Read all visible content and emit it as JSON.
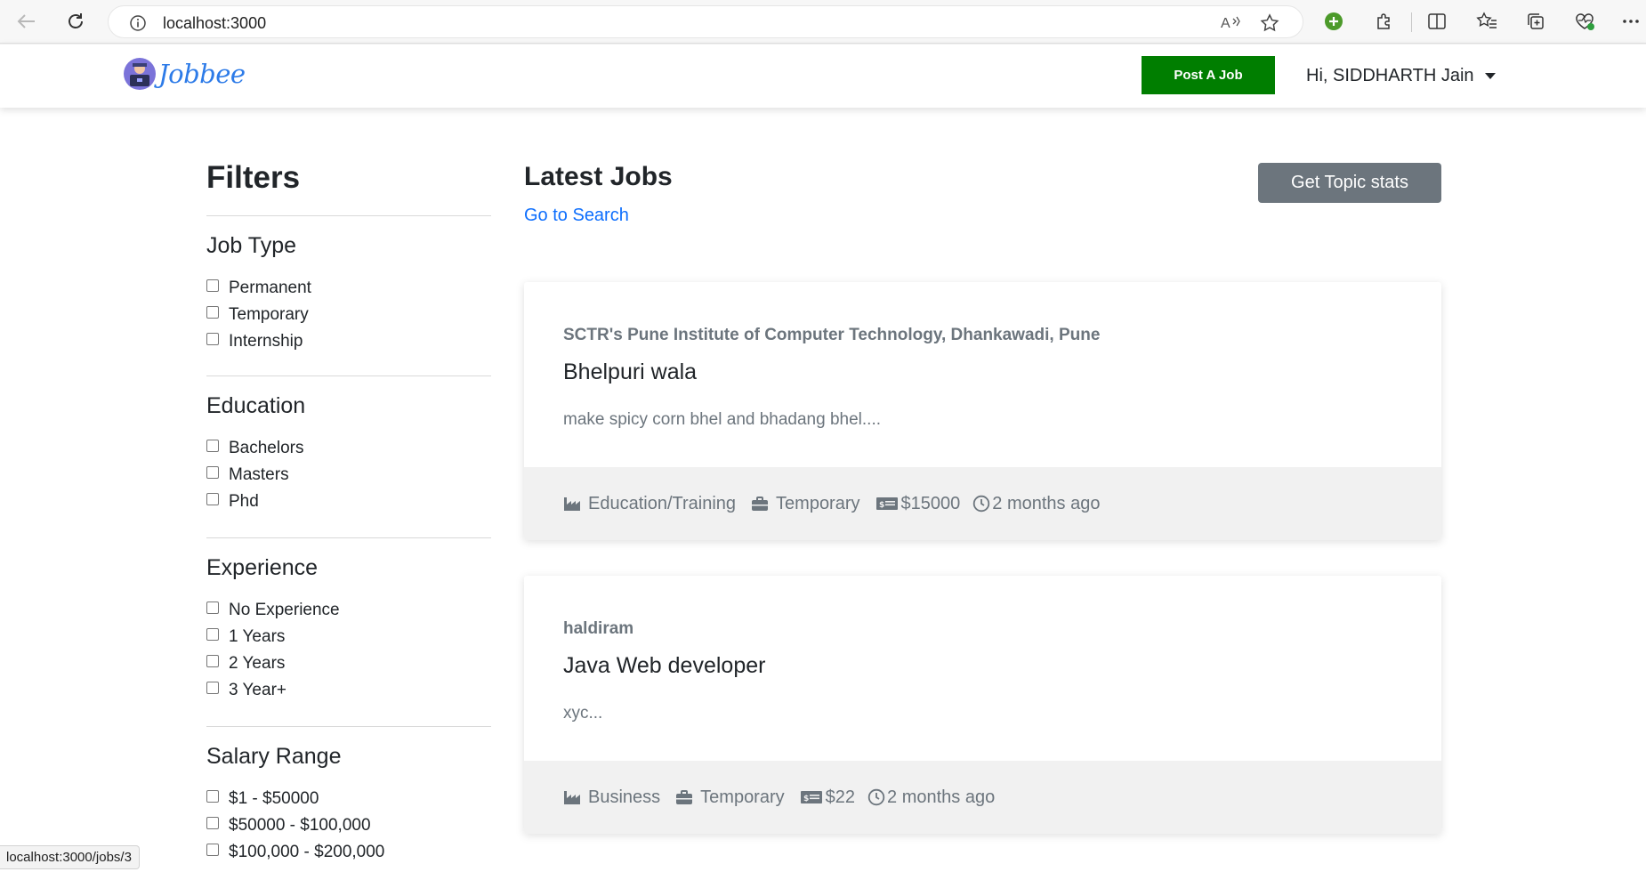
{
  "browser": {
    "url": "localhost:3000",
    "status_url": "localhost:3000/jobs/3"
  },
  "navbar": {
    "logo_text": "Jobbee",
    "post_job_label": "Post A Job",
    "user_greeting": "Hi, SIDDHARTH Jain"
  },
  "filters": {
    "title": "Filters",
    "job_type": {
      "title": "Job Type",
      "options": [
        "Permanent",
        "Temporary",
        "Internship"
      ]
    },
    "education": {
      "title": "Education",
      "options": [
        "Bachelors",
        "Masters",
        "Phd"
      ]
    },
    "experience": {
      "title": "Experience",
      "options": [
        "No Experience",
        "1 Years",
        "2 Years",
        "3 Year+"
      ]
    },
    "salary": {
      "title": "Salary Range",
      "options": [
        "$1 - $50000",
        "$50000 - $100,000",
        "$100,000 - $200,000"
      ]
    }
  },
  "main": {
    "title": "Latest Jobs",
    "search_link": "Go to Search",
    "stats_button": "Get Topic stats",
    "jobs": [
      {
        "company": "SCTR's Pune Institute of Computer Technology, Dhankawadi, Pune",
        "title": "Bhelpuri wala",
        "description": "make spicy corn bhel and bhadang bhel....",
        "industry": "Education/Training",
        "job_type": "Temporary",
        "salary": "$15000",
        "posted": "2 months ago"
      },
      {
        "company": "haldiram",
        "title": "Java Web developer",
        "description": "xyc...",
        "industry": "Business",
        "job_type": "Temporary",
        "salary": "$22",
        "posted": "2 months ago"
      }
    ]
  },
  "icons": {
    "industry": "industry-icon",
    "job_type": "briefcase-icon",
    "salary": "money-bill-icon",
    "posted": "clock-icon"
  },
  "colors": {
    "post_job_bg": "#007e00",
    "stats_btn_bg": "#6c757d",
    "link": "#0d6efd",
    "logo": "#2d7be8"
  }
}
